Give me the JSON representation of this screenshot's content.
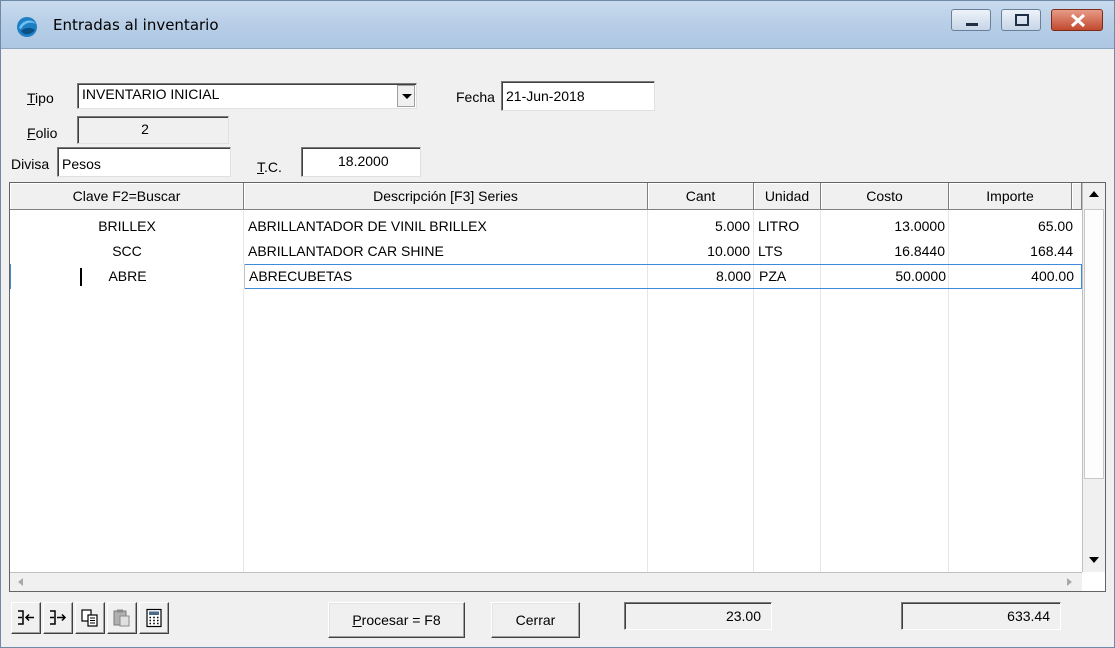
{
  "window": {
    "title": "Entradas al inventario",
    "accent": "#b9cfe7",
    "close_color": "#c24a2e"
  },
  "form": {
    "tipo_label_accel": "T",
    "tipo_label_rest": "ipo",
    "tipo_value": "INVENTARIO INICIAL",
    "fecha_label": "Fecha",
    "fecha_value": "21-Jun-2018",
    "folio_label_accel": "F",
    "folio_label_rest": "olio",
    "folio_value": "2",
    "divisa_label": "Divisa",
    "divisa_value": "Pesos",
    "tc_label_accel": "T",
    "tc_label_rest": ".C.",
    "tc_value": "18.2000"
  },
  "grid": {
    "columns": [
      "Clave F2=Buscar",
      "Descripción    [F3] Series",
      "Cant",
      "Unidad",
      "Costo",
      "Importe"
    ],
    "rows": [
      {
        "clave": "BRILLEX",
        "descripcion": "ABRILLANTADOR DE VINIL BRILLEX",
        "cant": "5.000",
        "unidad": "LITRO",
        "costo": "13.0000",
        "importe": "65.00"
      },
      {
        "clave": "SCC",
        "descripcion": "ABRILLANTADOR CAR SHINE",
        "cant": "10.000",
        "unidad": "LTS",
        "costo": "16.8440",
        "importe": "168.44"
      },
      {
        "clave": "ABRE",
        "descripcion": "ABRECUBETAS",
        "cant": "8.000",
        "unidad": "PZA",
        "costo": "50.0000",
        "importe": "400.00"
      }
    ],
    "selected_row": 2,
    "selection_color": "#3c8ad9"
  },
  "toolbar": {
    "icons": [
      "insert-row-icon",
      "append-row-icon",
      "copy-icon",
      "paste-icon",
      "calculator-icon"
    ]
  },
  "buttons": {
    "procesar_accel": "P",
    "procesar_rest": "rocesar = F8",
    "cerrar": "Cerrar"
  },
  "totals": {
    "cantidad": "23.00",
    "importe": "633.44"
  }
}
